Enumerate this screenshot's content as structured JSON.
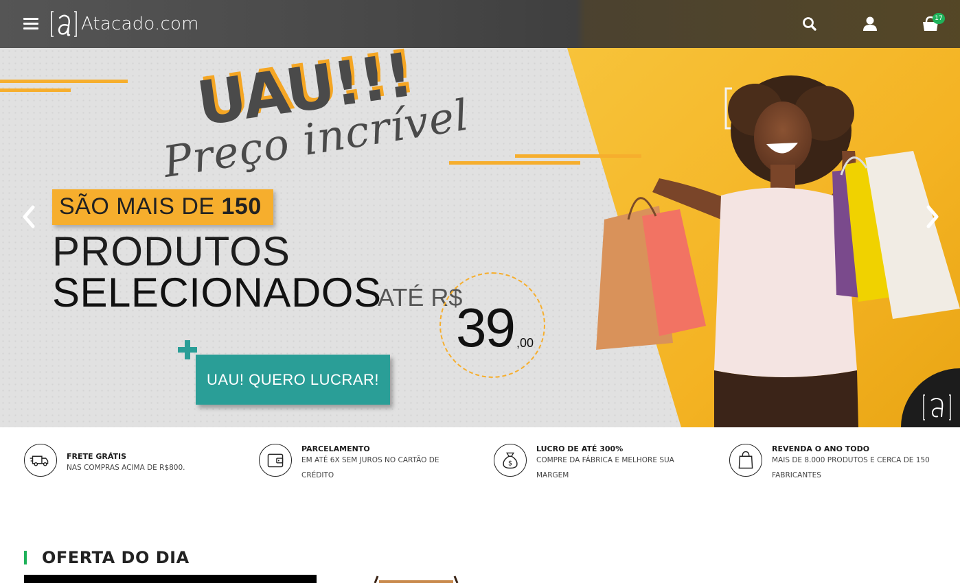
{
  "header": {
    "logo_text": "Atacado.com",
    "cart_count": "17",
    "icons": [
      "menu-icon",
      "search-icon",
      "user-icon",
      "cart-icon"
    ]
  },
  "banner": {
    "headline": "UAU!!!",
    "script_line": "Preço incrível",
    "sao_mais_de_prefix": "SÃO MAIS DE ",
    "sao_mais_de_number": "150",
    "line_produtos": "PRODUTOS",
    "line_selecionados": "SELECIONADOS",
    "ate_rs": "ATÉ R$",
    "price_int": "39",
    "price_cents": ",00",
    "cta_label": "UAU! QUERO LUCRAR!",
    "colors": {
      "accent_yellow": "#f6ae2d",
      "teal": "#2a9e97",
      "green_badge": "#1fb25a"
    }
  },
  "features": [
    {
      "title": "FRETE GRÁTIS",
      "desc_lines": [
        "NAS COMPRAS ACIMA DE R$800."
      ],
      "icon": "truck-icon"
    },
    {
      "title": "PARCELAMENTO",
      "desc_lines": [
        "EM ATÉ 6X SEM JUROS NO CARTÃO DE",
        "CRÉDITO"
      ],
      "icon": "wallet-icon"
    },
    {
      "title": "LUCRO DE ATÉ 300%",
      "desc_lines": [
        "COMPRE DA FÁBRICA E MELHORE SUA",
        "MARGEM"
      ],
      "icon": "money-bag-icon"
    },
    {
      "title": "REVENDA O ANO TODO",
      "desc_lines": [
        "MAIS DE 8.000 PRODUTOS E CERCA DE 150",
        "FABRICANTES"
      ],
      "icon": "shopping-bag-icon"
    }
  ],
  "offer": {
    "section_title": "OFERTA DO DIA"
  }
}
